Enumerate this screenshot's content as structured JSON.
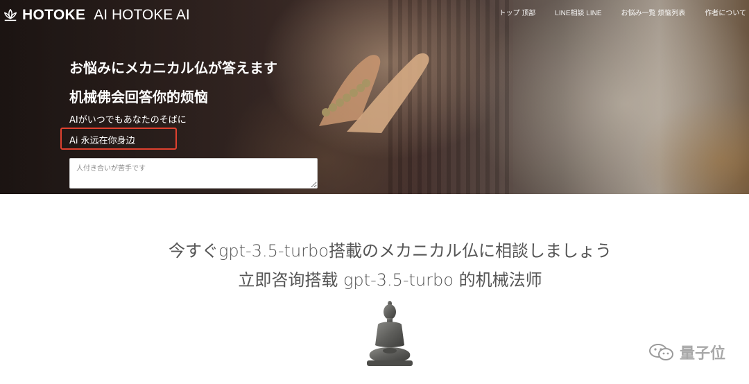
{
  "header": {
    "brand_bold": "HOTOKE",
    "brand_light": "AI HOTOKE AI",
    "logo_icon": "lotus-icon",
    "nav": [
      {
        "label": "トップ  顶部"
      },
      {
        "label": "LINE相談  LINE"
      },
      {
        "label": "お悩み一覧  烦恼列表"
      },
      {
        "label": "作者について"
      }
    ]
  },
  "hero": {
    "title_ja": "お悩みにメカニカル仏が答えます",
    "title_zh": "机械佛会回答你的烦恼",
    "subtitle_ja": "AIがいつでもあなたのそばに",
    "subtitle_zh": "Ai 永远在你身边",
    "highlight_color": "#e0412f",
    "input": {
      "value": "",
      "placeholder": "人付き合いが苦手です"
    }
  },
  "main": {
    "cta_ja": "今すぐgpt-3.5-turbo搭載のメカニカル仏に相談しましょう",
    "cta_zh": "立即咨询搭载 gpt-3.5-turbo 的机械法师",
    "buddha_icon": "buddha-statue-icon"
  },
  "watermark": {
    "text": "量子位",
    "icon": "wechat-icon"
  }
}
